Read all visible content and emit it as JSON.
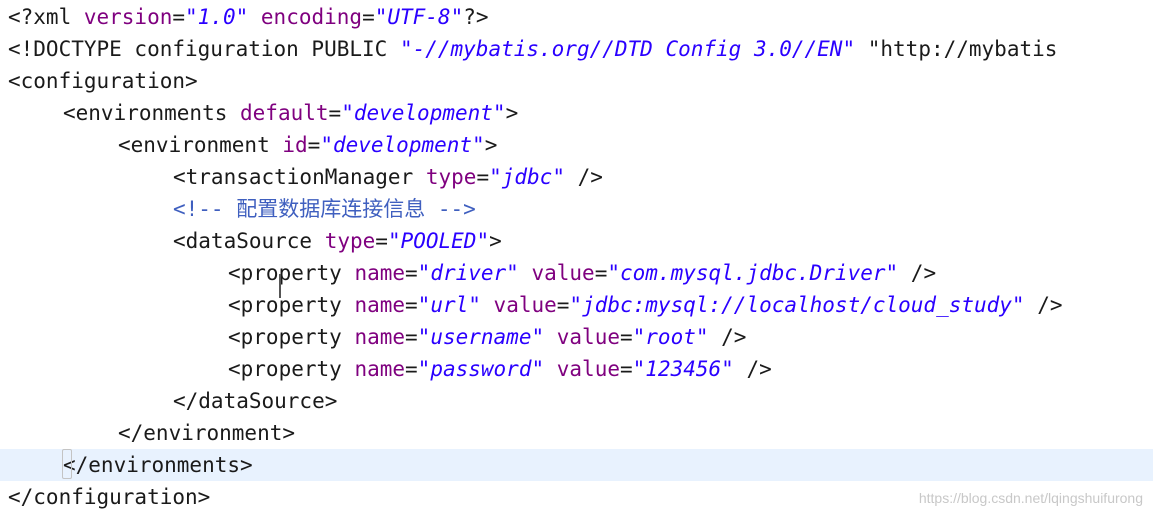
{
  "editor": {
    "lines": [
      {
        "indent": 0,
        "tokens": [
          {
            "t": "tag",
            "v": "<?xml "
          },
          {
            "t": "attr",
            "v": "version"
          },
          {
            "t": "eq",
            "v": "="
          },
          {
            "t": "val",
            "v": "\"1.0\""
          },
          {
            "t": "tag",
            "v": " "
          },
          {
            "t": "attr",
            "v": "encoding"
          },
          {
            "t": "eq",
            "v": "="
          },
          {
            "t": "val",
            "v": "\"UTF-8\""
          },
          {
            "t": "tag",
            "v": "?>"
          }
        ]
      },
      {
        "indent": 0,
        "tokens": [
          {
            "t": "tag",
            "v": "<!DOCTYPE configuration PUBLIC "
          },
          {
            "t": "val",
            "v": "\"-//mybatis.org//DTD Config 3.0//EN\""
          },
          {
            "t": "tag",
            "v": " "
          },
          {
            "t": "tag",
            "v": "\"http://mybatis"
          }
        ]
      },
      {
        "indent": 0,
        "tokens": [
          {
            "t": "tag",
            "v": "<configuration>"
          }
        ]
      },
      {
        "indent": 1,
        "tokens": [
          {
            "t": "tag",
            "v": "<environments "
          },
          {
            "t": "attr",
            "v": "default"
          },
          {
            "t": "eq",
            "v": "="
          },
          {
            "t": "val",
            "v": "\"development\""
          },
          {
            "t": "tag",
            "v": ">"
          }
        ]
      },
      {
        "indent": 2,
        "tokens": [
          {
            "t": "tag",
            "v": "<environment "
          },
          {
            "t": "attr",
            "v": "id"
          },
          {
            "t": "eq",
            "v": "="
          },
          {
            "t": "val",
            "v": "\"development\""
          },
          {
            "t": "tag",
            "v": ">"
          }
        ]
      },
      {
        "indent": 3,
        "tokens": [
          {
            "t": "tag",
            "v": "<transactionManager "
          },
          {
            "t": "attr",
            "v": "type"
          },
          {
            "t": "eq",
            "v": "="
          },
          {
            "t": "val",
            "v": "\"jdbc\""
          },
          {
            "t": "tag",
            "v": " />"
          }
        ]
      },
      {
        "indent": 3,
        "tokens": [
          {
            "t": "comment",
            "v": "<!-- 配置数据库连接信息 -->"
          }
        ]
      },
      {
        "indent": 3,
        "tokens": [
          {
            "t": "tag",
            "v": "<dataSource "
          },
          {
            "t": "attr",
            "v": "type"
          },
          {
            "t": "eq",
            "v": "="
          },
          {
            "t": "val",
            "v": "\"POOLED\""
          },
          {
            "t": "tag",
            "v": ">"
          }
        ]
      },
      {
        "indent": 4,
        "tokens": [
          {
            "t": "tag",
            "v": "<property "
          },
          {
            "t": "attr",
            "v": "name"
          },
          {
            "t": "eq",
            "v": "="
          },
          {
            "t": "val",
            "v": "\"driver\""
          },
          {
            "t": "tag",
            "v": " "
          },
          {
            "t": "attr",
            "v": "value"
          },
          {
            "t": "eq",
            "v": "="
          },
          {
            "t": "val",
            "v": "\"com.mysql.jdbc.Driver\""
          },
          {
            "t": "tag",
            "v": " />"
          }
        ]
      },
      {
        "indent": 4,
        "tokens": [
          {
            "t": "tag",
            "v": "<property "
          },
          {
            "t": "attr",
            "v": "name"
          },
          {
            "t": "eq",
            "v": "="
          },
          {
            "t": "val",
            "v": "\"url\""
          },
          {
            "t": "tag",
            "v": " "
          },
          {
            "t": "attr",
            "v": "value"
          },
          {
            "t": "eq",
            "v": "="
          },
          {
            "t": "val",
            "v": "\"jdbc:mysql://localhost/cloud_study\""
          },
          {
            "t": "tag",
            "v": " />"
          }
        ]
      },
      {
        "indent": 4,
        "tokens": [
          {
            "t": "tag",
            "v": "<property "
          },
          {
            "t": "attr",
            "v": "name"
          },
          {
            "t": "eq",
            "v": "="
          },
          {
            "t": "val",
            "v": "\"username\""
          },
          {
            "t": "tag",
            "v": " "
          },
          {
            "t": "attr",
            "v": "value"
          },
          {
            "t": "eq",
            "v": "="
          },
          {
            "t": "val",
            "v": "\"root\""
          },
          {
            "t": "tag",
            "v": " />"
          }
        ]
      },
      {
        "indent": 4,
        "tokens": [
          {
            "t": "tag",
            "v": "<property "
          },
          {
            "t": "attr",
            "v": "name"
          },
          {
            "t": "eq",
            "v": "="
          },
          {
            "t": "val",
            "v": "\"password\""
          },
          {
            "t": "tag",
            "v": " "
          },
          {
            "t": "attr",
            "v": "value"
          },
          {
            "t": "eq",
            "v": "="
          },
          {
            "t": "val",
            "v": "\"123456\""
          },
          {
            "t": "tag",
            "v": " />"
          }
        ]
      },
      {
        "indent": 3,
        "tokens": [
          {
            "t": "tag",
            "v": "</dataSource>"
          }
        ]
      },
      {
        "indent": 2,
        "tokens": [
          {
            "t": "tag",
            "v": "</environment>"
          }
        ]
      },
      {
        "indent": 1,
        "current": true,
        "tokens": [
          {
            "t": "tag",
            "v": "</environments>"
          }
        ]
      },
      {
        "indent": 0,
        "tokens": [
          {
            "t": "tag",
            "v": "</configuration>"
          }
        ]
      }
    ]
  },
  "colors": {
    "tag": "#1a1a1a",
    "attribute": "#7f007f",
    "value": "#2a00ff",
    "comment": "#3f5fbf",
    "current_line": "#e8f2fe"
  },
  "watermark": "https://blog.csdn.net/lqingshuifurong"
}
